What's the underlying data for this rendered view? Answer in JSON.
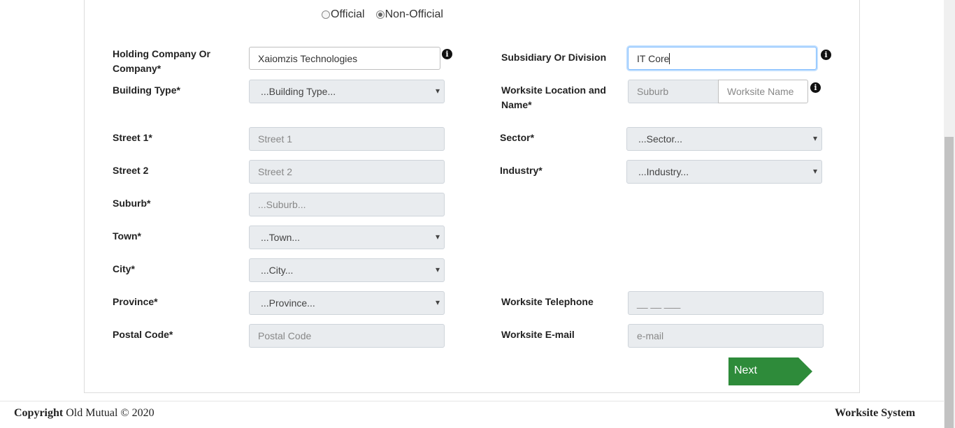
{
  "radio": {
    "official_label": "Official",
    "non_official_label": "Non-Official",
    "selected": "Non-Official"
  },
  "left": {
    "holding_company_label_1": "Holding Company Or",
    "holding_company_label_2": "Company*",
    "holding_company_value": "Xaiomzis Technologies",
    "building_type_label": "Building Type*",
    "building_type_value": "...Building Type...",
    "street1_label": "Street 1*",
    "street1_placeholder": "Street 1",
    "street2_label": "Street 2",
    "street2_placeholder": "Street 2",
    "suburb_label": "Suburb*",
    "suburb_placeholder": "...Suburb...",
    "town_label": "Town*",
    "town_value": "...Town...",
    "city_label": "City*",
    "city_value": "...City...",
    "province_label": "Province*",
    "province_value": "...Province...",
    "postal_code_label": "Postal Code*",
    "postal_code_placeholder": "Postal Code"
  },
  "right": {
    "subsidiary_label": "Subsidiary Or Division",
    "subsidiary_value": "IT Core",
    "worksite_location_label_1": "Worksite Location and",
    "worksite_location_label_2": "Name*",
    "worksite_suburb_placeholder": "Suburb",
    "worksite_name_placeholder": "Worksite Name",
    "sector_label": "Sector*",
    "sector_value": "...Sector...",
    "industry_label": "Industry*",
    "industry_value": "...Industry...",
    "telephone_label": "Worksite Telephone",
    "telephone_placeholder": "__ __ ___",
    "email_label": "Worksite E-mail",
    "email_placeholder": "e-mail"
  },
  "buttons": {
    "next_label": "Next"
  },
  "footer": {
    "copyright_bold": "Copyright",
    "copyright_rest": " Old Mutual © 2020",
    "system_name": "Worksite System"
  },
  "icons": {
    "info": "i",
    "select_arrow": "chevron-down-icon"
  },
  "colors": {
    "next_button": "#2e8b3a",
    "input_disabled_bg": "#e9ecef",
    "focus_border": "#80bdff"
  }
}
